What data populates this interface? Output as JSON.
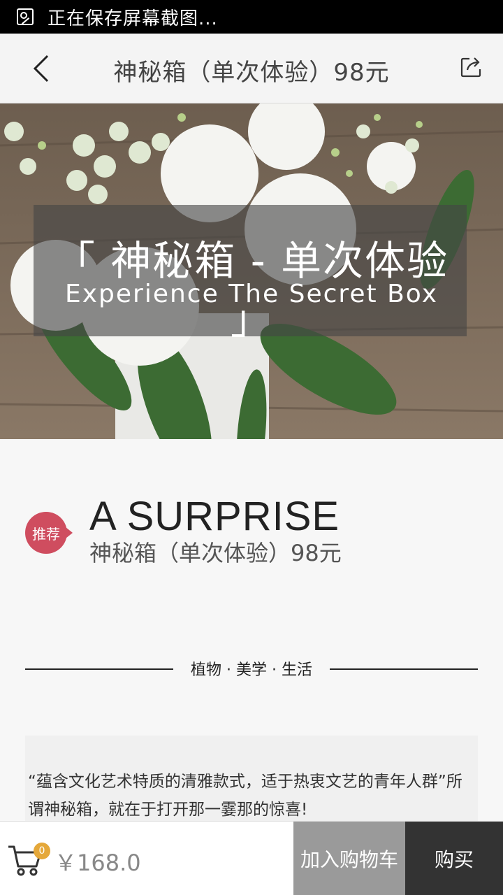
{
  "status_bar": {
    "text": "正在保存屏幕截图..."
  },
  "header": {
    "title": "神秘箱（单次体验）98元",
    "back_icon": "chevron-left-icon",
    "share_icon": "share-icon"
  },
  "hero": {
    "title": "「 神秘箱 - 单次体验 」",
    "subtitle": "Experience The Secret Box"
  },
  "product": {
    "badge": "推荐",
    "headline": "A SURPRISE",
    "subheadline": "神秘箱（单次体验）98元"
  },
  "divider": {
    "text": "植物 · 美学 · 生活"
  },
  "description": {
    "text": "“蕴含文化艺术特质的清雅款式，适于热衷文艺的青年人群”所谓神秘箱，就在于打开那一霎那的惊喜!"
  },
  "bottom_bar": {
    "cart_count": "0",
    "price": "￥168.0",
    "add_to_cart_label": "加入购物车",
    "buy_label": "购买",
    "cart_icon": "shopping-cart-icon"
  },
  "colors": {
    "badge": "#cf4d5f",
    "cart_count_badge": "#e5a83a",
    "add_to_cart_bg": "#9a9a9a",
    "buy_bg": "#333333"
  }
}
